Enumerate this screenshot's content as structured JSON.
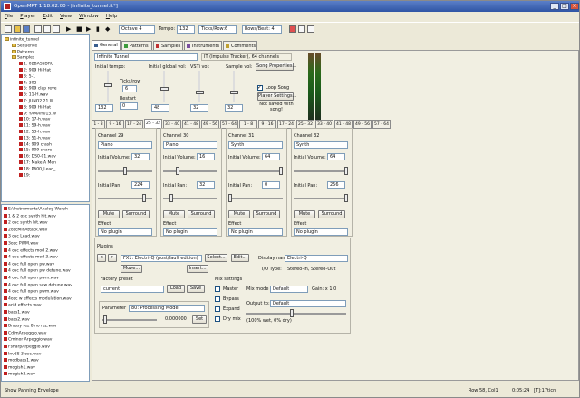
{
  "window": {
    "title": "OpenMPT 1.18.02.00 - [infinite_tunnel.it*]"
  },
  "menu": [
    "File",
    "Player",
    "Edit",
    "View",
    "Window",
    "Help"
  ],
  "toolbar": {
    "octave": "Octave 4",
    "tempo_label": "Tempo:",
    "tempo": "132",
    "ticks": "Ticks/Row:6",
    "rows_beat": "Rows/Beat: 4"
  },
  "tree": {
    "items": [
      {
        "label": "infinite_tunnel",
        "d": 0,
        "t": "f"
      },
      {
        "label": "Sequence",
        "d": 1,
        "t": "f"
      },
      {
        "label": "Patterns",
        "d": 1,
        "t": "f"
      },
      {
        "label": "Samples",
        "d": 1,
        "t": "f"
      },
      {
        "label": "1: 02BASSDRU",
        "d": 2,
        "t": "n"
      },
      {
        "label": "2: 909 Hi-Hat",
        "d": 2,
        "t": "n"
      },
      {
        "label": "3: 5-1",
        "d": 2,
        "t": "n"
      },
      {
        "label": "4: 302",
        "d": 2,
        "t": "n"
      },
      {
        "label": "5: 909 clap reve",
        "d": 2,
        "t": "n"
      },
      {
        "label": "6: 11-H.wav",
        "d": 2,
        "t": "n"
      },
      {
        "label": "7: JUNO2 21.W",
        "d": 2,
        "t": "n"
      },
      {
        "label": "8: 909 Hi-Hat",
        "d": 2,
        "t": "n"
      },
      {
        "label": "9: YAMAH015.W",
        "d": 2,
        "t": "n"
      },
      {
        "label": "10: 17-h.wav",
        "d": 2,
        "t": "n"
      },
      {
        "label": "11: S9-h.wav",
        "d": 2,
        "t": "n"
      },
      {
        "label": "12: 53-h.wav",
        "d": 2,
        "t": "n"
      },
      {
        "label": "13: 51-h.wav",
        "d": 2,
        "t": "n"
      },
      {
        "label": "14: 909 crash",
        "d": 2,
        "t": "n"
      },
      {
        "label": "15: 909 snare",
        "d": 2,
        "t": "n"
      },
      {
        "label": "16: DS0-01.wav",
        "d": 2,
        "t": "n"
      },
      {
        "label": "17: Make A Men",
        "d": 2,
        "t": "n"
      },
      {
        "label": "18: P600_Lead_",
        "d": 2,
        "t": "n"
      },
      {
        "label": "19:",
        "d": 2,
        "t": "n"
      }
    ]
  },
  "files": [
    "E:\\Instruments\\Analog Warph",
    "1 & 2 osc synth hit.wav",
    "2 osc synth hit.wav",
    "2oscMidAttack.wav",
    "3 osc Lead.wav",
    "3osc PWM.wav",
    "4 osc effects mod 2.wav",
    "4 osc effects mod 3.wav",
    "4 osc full open pw.wav",
    "4 osc full open pw detune.wav",
    "4 osc full open pwm.wav",
    "4 osc full open saw detune.wav",
    "4 osc full open pwm.wav",
    "4osc w effects modulation.wav",
    "acid effects.wav",
    "bass1.wav",
    "bass2.wav",
    "Brassy rez 8 no rez.wav",
    "CdimArpeggio.wav",
    "Cminor Arpeggio.wav",
    "FsharpArpeggio.wav",
    "InvSS 3 osc.wav",
    "modbass1.wav",
    "mogish1.wav",
    "mogish2.wav"
  ],
  "tabs": [
    "General",
    "Patterns",
    "Samples",
    "Instruments",
    "Comments"
  ],
  "general": {
    "song_name": "Infinite Tunnel",
    "format": "IT (Impulse Tracker), 64 channels",
    "song_props": "Song Properties...",
    "initial_tempo": "Initial tempo:",
    "ticks_row": "Ticks/row",
    "ticks_val": "6",
    "tempo_val": "132",
    "restart": "Restart",
    "restart_val": "0",
    "igv": "Initial global vol:",
    "igv_val": "48",
    "vsti": "VSTi vol:",
    "vsti_val": "32",
    "sample": "Sample vol:",
    "sample_val": "32",
    "loop": "Loop Song",
    "player": "Player Settings...",
    "not_saved": "Not saved with song!"
  },
  "channel_tabs": [
    "1 - 8",
    "9 - 16",
    "17 - 24",
    "25 - 32",
    "33 - 40",
    "41 - 48",
    "49 - 56",
    "57 - 64",
    "1 - 8",
    "9 - 16",
    "17 - 24",
    "25 - 32",
    "33 - 40",
    "41 - 48",
    "49 - 56",
    "57 - 64"
  ],
  "channel_tab_labels": [
    "1 - 8",
    "9 - 16",
    "17 - 24",
    "25 - 32",
    "33 - 40",
    "41 - 48",
    "49 - 56",
    "57 - 64"
  ],
  "channels": [
    {
      "title": "Channel 29",
      "name": "Piano",
      "vol": "32",
      "pan": "224"
    },
    {
      "title": "Channel 30",
      "name": "Piano",
      "vol": "16",
      "pan": "32"
    },
    {
      "title": "Channel 31",
      "name": "Synth",
      "vol": "64",
      "pan": "0"
    },
    {
      "title": "Channel 32",
      "name": "Synth",
      "vol": "64",
      "pan": "256"
    }
  ],
  "channel_labels": {
    "init_vol": "Initial Volume:",
    "init_pan": "Initial Pan:",
    "mute": "Mute",
    "surround": "Surround",
    "effect": "Effect",
    "no_plugin": "No plugin"
  },
  "plugins": {
    "title": "Plugins",
    "fx": "FX1: Electri-Q (post/fault edition)",
    "select": "Select...",
    "edit": "Edit...",
    "display": "Display name",
    "display_val": "Electri-Q",
    "move": "Move...",
    "insert": "Insert...",
    "io_type": "I/O Type:",
    "io_val": "Stereo-In, Stereo-Out",
    "factory": "Factory preset",
    "current": "current",
    "load": "Load",
    "save": "Save",
    "mix": "Mix settings",
    "master": "Master",
    "bypass": "Bypass",
    "expand": "Expand",
    "dry": "Dry mix",
    "mix_mode": "Mix mode",
    "mix_mode_val": "Default",
    "gain": "Gain: x 1.0",
    "output": "Output to:",
    "output_val": "Default",
    "wet": "(100% wet, 0% dry)",
    "param": "Parameter",
    "param_val": "80: Processing Mode",
    "param_num": "0.000000",
    "set": "Set"
  },
  "status": {
    "text": "Show Panning Envelope",
    "row": "Row 58, Col1",
    "time": "0:05:24",
    "mem": "[T]:17ticn"
  },
  "ctab_labels": [
    "1 - 8",
    "9 - 16",
    "17 - 24",
    "25 - 32",
    "33 - 40",
    "41 - 48",
    "49 - 56",
    "57 - 64",
    "1 - 8",
    "9 - 16",
    "17 - 24",
    "25 - 32",
    "33 - 40",
    "41 - 48",
    "49 - 56",
    "57 - 64"
  ]
}
